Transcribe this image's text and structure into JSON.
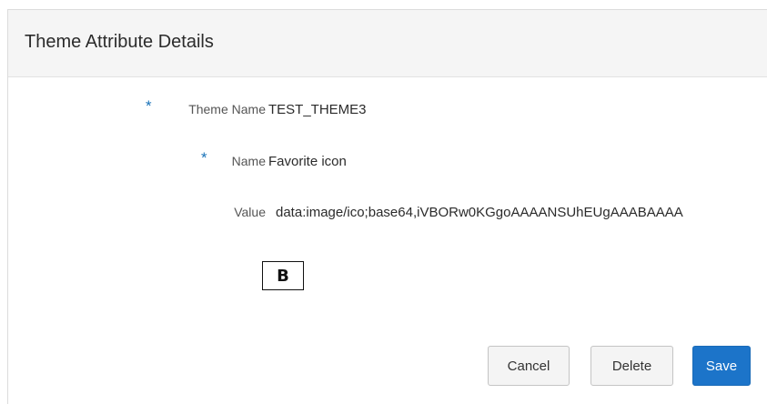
{
  "header": {
    "title": "Theme Attribute Details"
  },
  "fields": {
    "theme_name": {
      "required_mark": "*",
      "label": "Theme Name",
      "value": "TEST_THEME3"
    },
    "name": {
      "required_mark": "*",
      "label": "Name",
      "value": "Favorite icon"
    },
    "value": {
      "label": "Value",
      "value": "data:image/ico;base64,iVBORw0KGgoAAAANSUhEUgAAABAAAA"
    }
  },
  "preview": {
    "glyph": "B"
  },
  "actions": {
    "cancel_label": "Cancel",
    "delete_label": "Delete",
    "save_label": "Save"
  },
  "colors": {
    "required": "#1a73b8",
    "primary_button": "#1c74c9",
    "header_background": "#f5f5f5"
  }
}
